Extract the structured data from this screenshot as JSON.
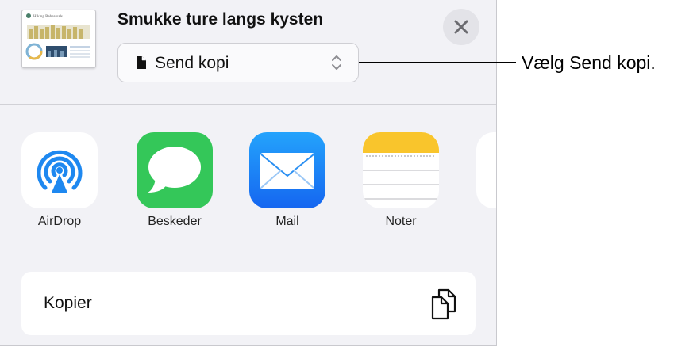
{
  "header": {
    "doc_title": "Smukke ture langs kysten",
    "send_option": "Send kopi",
    "thumbnail_title": "Hiking Rehearsals"
  },
  "apps": [
    {
      "label": "AirDrop"
    },
    {
      "label": "Beskeder"
    },
    {
      "label": "Mail"
    },
    {
      "label": "Noter"
    }
  ],
  "actions": {
    "copy_label": "Kopier"
  },
  "callout": {
    "text": "Vælg Send kopi."
  },
  "colors": {
    "messages_green": "#34c759",
    "mail_blue": "#1f8bf5",
    "notes_yellow": "#f9c52c",
    "airdrop_blue": "#1e88f0"
  }
}
